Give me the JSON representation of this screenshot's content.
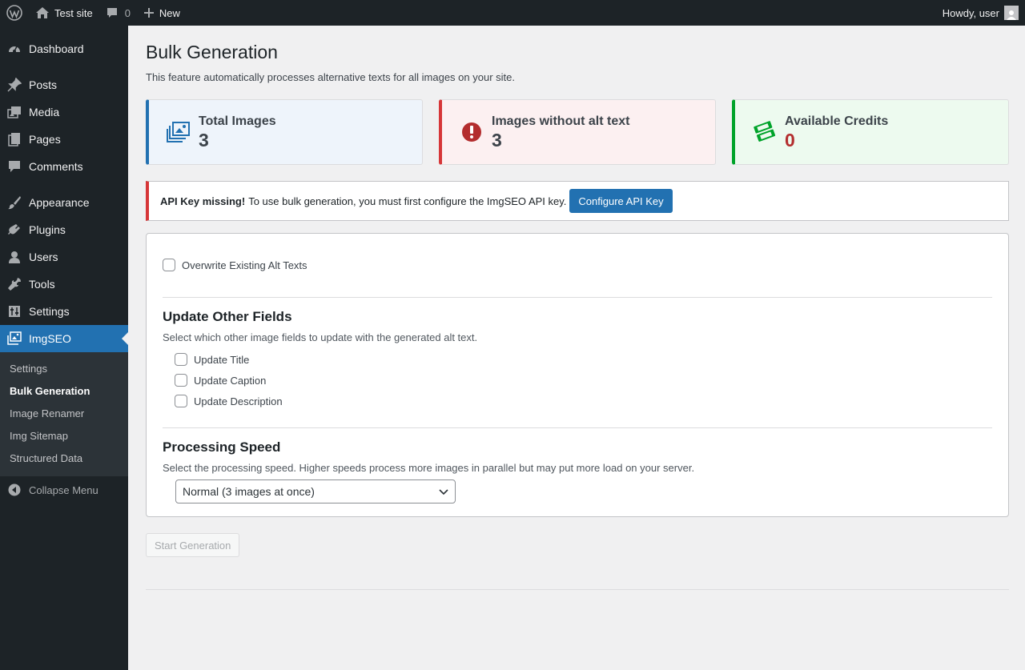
{
  "adminbar": {
    "site_name": "Test site",
    "comments_count": "0",
    "new_label": "New",
    "howdy": "Howdy, user"
  },
  "sidebar": {
    "items": [
      {
        "label": "Dashboard",
        "icon": "dashboard-icon"
      },
      {
        "label": "Posts",
        "icon": "pin-icon"
      },
      {
        "label": "Media",
        "icon": "media-icon"
      },
      {
        "label": "Pages",
        "icon": "pages-icon"
      },
      {
        "label": "Comments",
        "icon": "comment-icon"
      },
      {
        "label": "Appearance",
        "icon": "brush-icon"
      },
      {
        "label": "Plugins",
        "icon": "plug-icon"
      },
      {
        "label": "Users",
        "icon": "user-icon"
      },
      {
        "label": "Tools",
        "icon": "wrench-icon"
      },
      {
        "label": "Settings",
        "icon": "settings-icon"
      },
      {
        "label": "ImgSEO",
        "icon": "images-icon"
      }
    ],
    "submenu": [
      "Settings",
      "Bulk Generation",
      "Image Renamer",
      "Img Sitemap",
      "Structured Data"
    ],
    "collapse_label": "Collapse Menu"
  },
  "page": {
    "title": "Bulk Generation",
    "intro": "This feature automatically processes alternative texts for all images on your site."
  },
  "cards": [
    {
      "title": "Total Images",
      "value": "3",
      "color": "#2271b1"
    },
    {
      "title": "Images without alt text",
      "value": "3",
      "color": "#d63638"
    },
    {
      "title": "Available Credits",
      "value": "0",
      "color": "#00a32a"
    }
  ],
  "notice": {
    "strong": "API Key missing!",
    "text": "To use bulk generation, you must first configure the ImgSEO API key.",
    "button": "Configure API Key"
  },
  "options": {
    "overwrite_label": "Overwrite Existing Alt Texts",
    "other_fields_title": "Update Other Fields",
    "other_fields_desc": "Select which other image fields to update with the generated alt text.",
    "update_title": "Update Title",
    "update_caption": "Update Caption",
    "update_description": "Update Description",
    "speed_title": "Processing Speed",
    "speed_desc": "Select the processing speed. Higher speeds process more images in parallel but may put more load on your server.",
    "speed_selected": "Normal (3 images at once)"
  },
  "start_button": "Start Generation"
}
